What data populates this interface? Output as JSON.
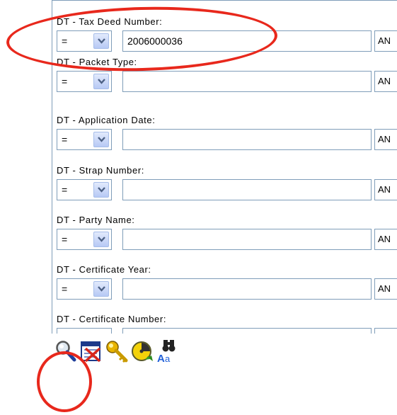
{
  "fields": [
    {
      "label": "DT - Tax Deed Number:",
      "operator": "=",
      "value": "2006000036",
      "conjunction": "AN"
    },
    {
      "label": "DT - Packet Type:",
      "operator": "=",
      "value": "",
      "conjunction": "AN"
    },
    {
      "label": "DT - Application Date:",
      "operator": "=",
      "value": "",
      "conjunction": "AN"
    },
    {
      "label": "DT - Strap Number:",
      "operator": "=",
      "value": "",
      "conjunction": "AN"
    },
    {
      "label": "DT - Party Name:",
      "operator": "=",
      "value": "",
      "conjunction": "AN"
    },
    {
      "label": "DT - Certificate Year:",
      "operator": "=",
      "value": "",
      "conjunction": "AN"
    },
    {
      "label": "DT - Certificate Number:",
      "operator": "",
      "value": "",
      "conjunction": ""
    }
  ],
  "toolbar": [
    {
      "icon": "magnifier-icon"
    },
    {
      "icon": "clear-form-icon"
    },
    {
      "icon": "key-icon"
    },
    {
      "icon": "clock-icon"
    },
    {
      "icon": "binoculars-text-icon"
    }
  ],
  "annotation_color": "#e8281c"
}
